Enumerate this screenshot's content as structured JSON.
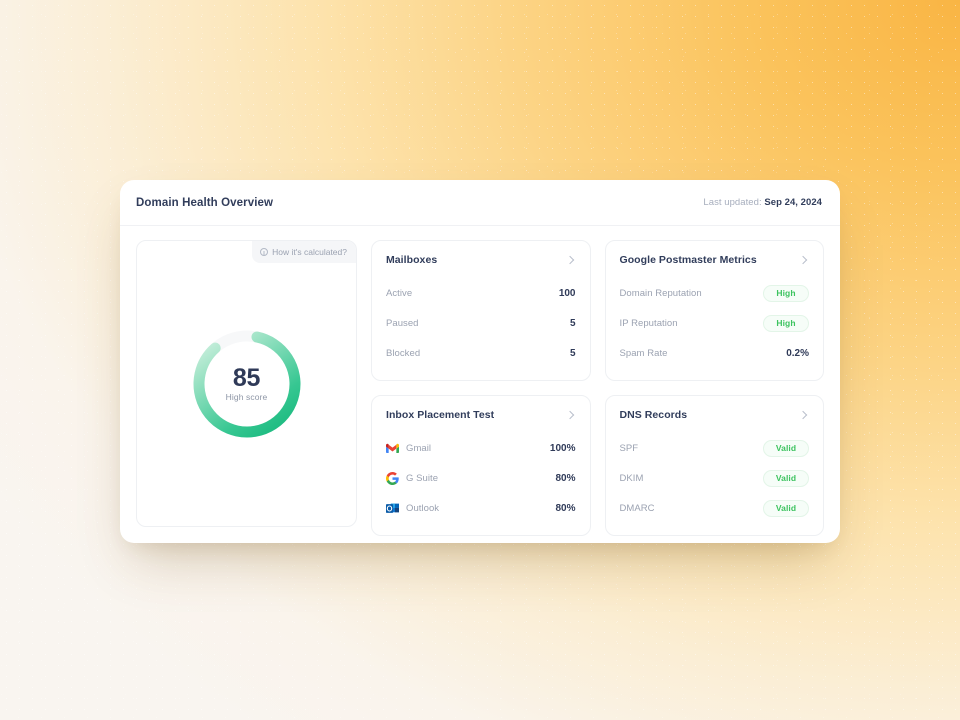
{
  "background": {
    "gradient_from": "#faf5ee",
    "gradient_to": "#f9b544"
  },
  "panel": {
    "title": "Domain Health Overview",
    "updated_prefix": "Last updated:",
    "updated_date": "Sep 24, 2024"
  },
  "score_card": {
    "how_calculated_label": "How it's calculated?",
    "info_icon": "info-circle-icon",
    "score": "85",
    "score_numeric": 85,
    "score_label": "High score",
    "ring_color_start": "#d8f2e4",
    "ring_color_end": "#15b87c",
    "track_color": "#f7f8f9"
  },
  "cards": [
    {
      "id": "mailboxes",
      "title": "Mailboxes",
      "chevron_icon": "chevron-right-icon",
      "rows": [
        {
          "label": "Active",
          "value": "100",
          "type": "value"
        },
        {
          "label": "Paused",
          "value": "5",
          "type": "value"
        },
        {
          "label": "Blocked",
          "value": "5",
          "type": "value"
        }
      ]
    },
    {
      "id": "google-postmaster-metrics",
      "title": "Google Postmaster Metrics",
      "chevron_icon": "chevron-right-icon",
      "rows": [
        {
          "label": "Domain Reputation",
          "value": "High",
          "type": "badge"
        },
        {
          "label": "IP Reputation",
          "value": "High",
          "type": "badge"
        },
        {
          "label": "Spam Rate",
          "value": "0.2%",
          "type": "value"
        }
      ]
    },
    {
      "id": "inbox-placement-test",
      "title": "Inbox Placement Test",
      "chevron_icon": "chevron-right-icon",
      "rows": [
        {
          "label": "Gmail",
          "value": "100%",
          "type": "value",
          "icon": "gmail-icon"
        },
        {
          "label": "G Suite",
          "value": "80%",
          "type": "value",
          "icon": "google-icon"
        },
        {
          "label": "Outlook",
          "value": "80%",
          "type": "value",
          "icon": "outlook-icon"
        }
      ]
    },
    {
      "id": "dns-records",
      "title": "DNS Records",
      "chevron_icon": "chevron-right-icon",
      "rows": [
        {
          "label": "SPF",
          "value": "Valid",
          "type": "badge"
        },
        {
          "label": "DKIM",
          "value": "Valid",
          "type": "badge"
        },
        {
          "label": "DMARC",
          "value": "Valid",
          "type": "badge"
        }
      ]
    }
  ],
  "colors": {
    "accent_green": "#3cc35f",
    "badge_bg": "#f6fdf8",
    "badge_border": "#e3f5e8",
    "text_dark": "#2f3a58",
    "text_muted": "#9ba2b1"
  }
}
